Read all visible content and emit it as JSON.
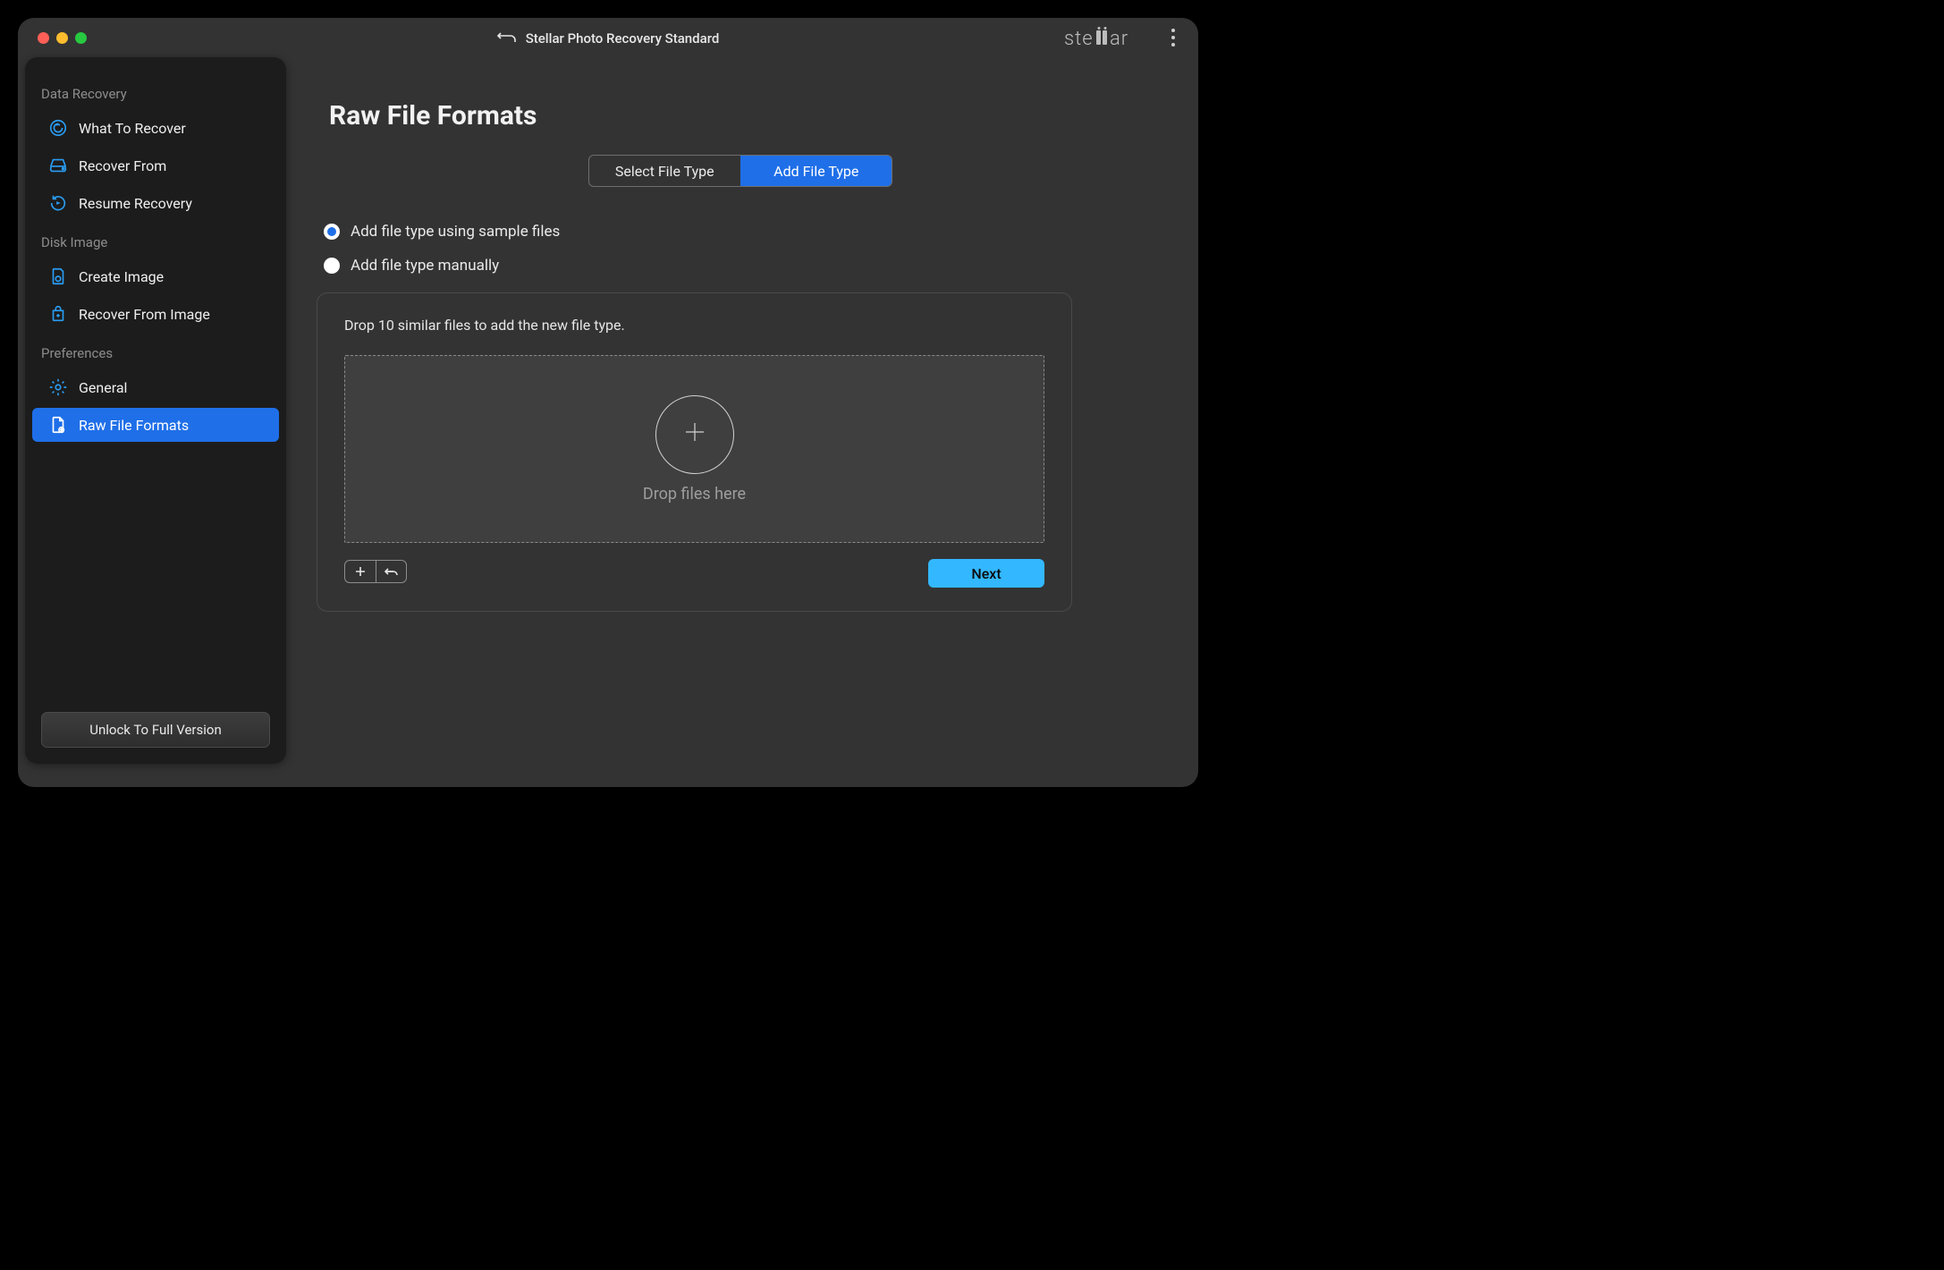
{
  "titlebar": {
    "title": "Stellar Photo Recovery Standard",
    "brand": "stellar"
  },
  "sidebar": {
    "sections": [
      {
        "label": "Data Recovery",
        "items": [
          {
            "id": "what-to-recover",
            "label": "What To Recover"
          },
          {
            "id": "recover-from",
            "label": "Recover From"
          },
          {
            "id": "resume-recovery",
            "label": "Resume Recovery"
          }
        ]
      },
      {
        "label": "Disk Image",
        "items": [
          {
            "id": "create-image",
            "label": "Create Image"
          },
          {
            "id": "recover-from-image",
            "label": "Recover From Image"
          }
        ]
      },
      {
        "label": "Preferences",
        "items": [
          {
            "id": "general",
            "label": "General"
          },
          {
            "id": "raw-file-formats",
            "label": "Raw File Formats",
            "selected": true
          }
        ]
      }
    ],
    "unlock_label": "Unlock To Full Version"
  },
  "main": {
    "page_title": "Raw File Formats",
    "tabs": {
      "select": "Select File Type",
      "add": "Add File Type",
      "active": "add"
    },
    "radios": {
      "sample": "Add file type using sample files",
      "manual": "Add file type manually",
      "selected": "sample"
    },
    "panel": {
      "hint": "Drop 10 similar files to add the new file type.",
      "drop_label": "Drop files here"
    },
    "next_label": "Next"
  },
  "colors": {
    "accent_blue": "#1f6fe8",
    "cta_blue": "#33b8ff",
    "icon_blue": "#2a9df4"
  }
}
